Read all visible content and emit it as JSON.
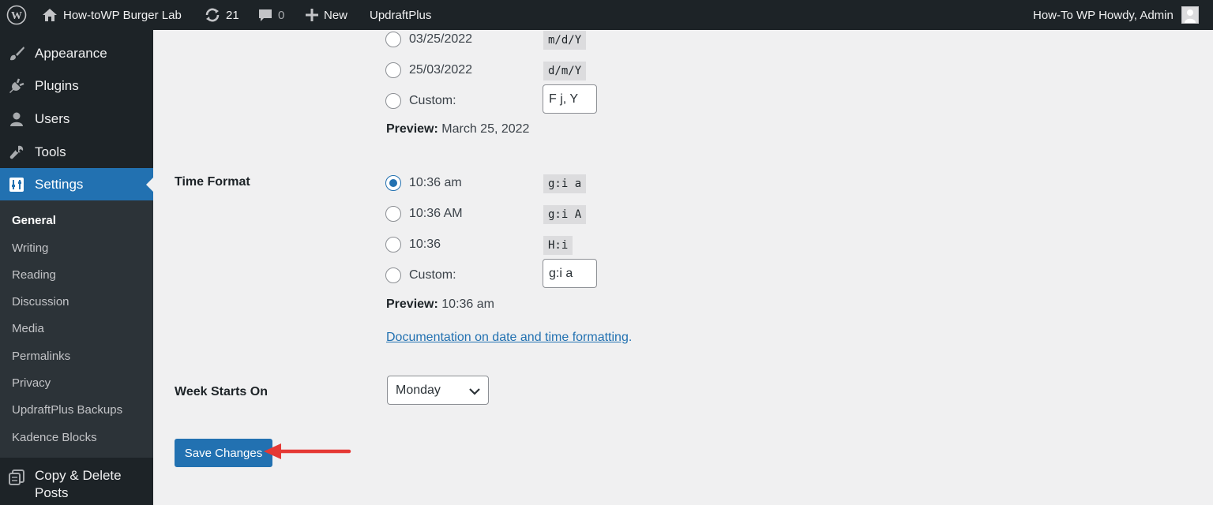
{
  "adminbar": {
    "site_name": "How-toWP Burger Lab",
    "updates_count": "21",
    "comments_count": "0",
    "new_label": "New",
    "updraft_label": "UpdraftPlus",
    "account_label": "How-To WP Howdy, Admin"
  },
  "sidebar": {
    "menu": [
      {
        "label": "Appearance",
        "icon": "paintbrush-icon"
      },
      {
        "label": "Plugins",
        "icon": "plugin-icon"
      },
      {
        "label": "Users",
        "icon": "users-icon"
      },
      {
        "label": "Tools",
        "icon": "wrench-icon"
      },
      {
        "label": "Settings",
        "icon": "settings-icon",
        "active": true
      }
    ],
    "submenu": [
      "General",
      "Writing",
      "Reading",
      "Discussion",
      "Media",
      "Permalinks",
      "Privacy",
      "UpdraftPlus Backups",
      "Kadence Blocks"
    ],
    "current_submenu": "General",
    "extra_menu": {
      "label": "Copy & Delete Posts",
      "icon": "copy-icon"
    }
  },
  "date_format": {
    "options": [
      {
        "label": "03/25/2022",
        "code": "m/d/Y",
        "checked": false
      },
      {
        "label": "25/03/2022",
        "code": "d/m/Y",
        "checked": false
      }
    ],
    "custom_label": "Custom:",
    "custom_value": "F j, Y",
    "preview_label": "Preview:",
    "preview_value": "March 25, 2022"
  },
  "time_format": {
    "label": "Time Format",
    "options": [
      {
        "label": "10:36 am",
        "code": "g:i a",
        "checked": true
      },
      {
        "label": "10:36 AM",
        "code": "g:i A",
        "checked": false
      },
      {
        "label": "10:36",
        "code": "H:i",
        "checked": false
      }
    ],
    "custom_label": "Custom:",
    "custom_value": "g:i a",
    "preview_label": "Preview:",
    "preview_value": "10:36 am"
  },
  "doc_link": {
    "text": "Documentation on date and time formatting",
    "suffix": "."
  },
  "week_starts": {
    "label": "Week Starts On",
    "value": "Monday"
  },
  "save_label": "Save Changes",
  "colors": {
    "accent": "#2271b1",
    "adminbar": "#1d2327",
    "submenu_bg": "#2c3338",
    "arrow": "#e53935"
  }
}
